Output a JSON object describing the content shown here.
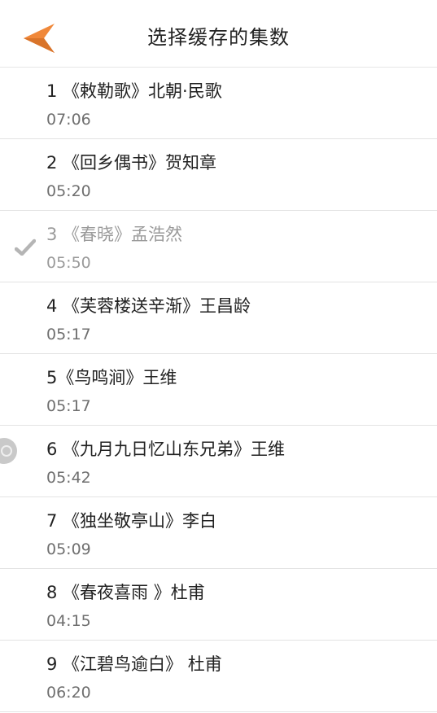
{
  "header": {
    "title": "选择缓存的集数",
    "back_icon": "back-arrow-icon",
    "accent_color": "#F0883A"
  },
  "episodes": [
    {
      "name": "1 《敕勒歌》北朝·民歌",
      "duration": "07:06",
      "status": "none"
    },
    {
      "name": "2 《回乡偶书》贺知章",
      "duration": "05:20",
      "status": "none"
    },
    {
      "name": "3 《春晓》孟浩然",
      "duration": "05:50",
      "status": "downloaded"
    },
    {
      "name": "4 《芙蓉楼送辛渐》王昌龄",
      "duration": "05:17",
      "status": "none"
    },
    {
      "name": "5《鸟鸣涧》王维",
      "duration": "05:17",
      "status": "none"
    },
    {
      "name": "6 《九月九日忆山东兄弟》王维",
      "duration": "05:42",
      "status": "downloading"
    },
    {
      "name": "7 《独坐敬亭山》李白",
      "duration": "05:09",
      "status": "none"
    },
    {
      "name": "8 《春夜喜雨 》杜甫",
      "duration": "04:15",
      "status": "none"
    },
    {
      "name": "9 《江碧鸟逾白》 杜甫",
      "duration": "06:20",
      "status": "none"
    }
  ]
}
